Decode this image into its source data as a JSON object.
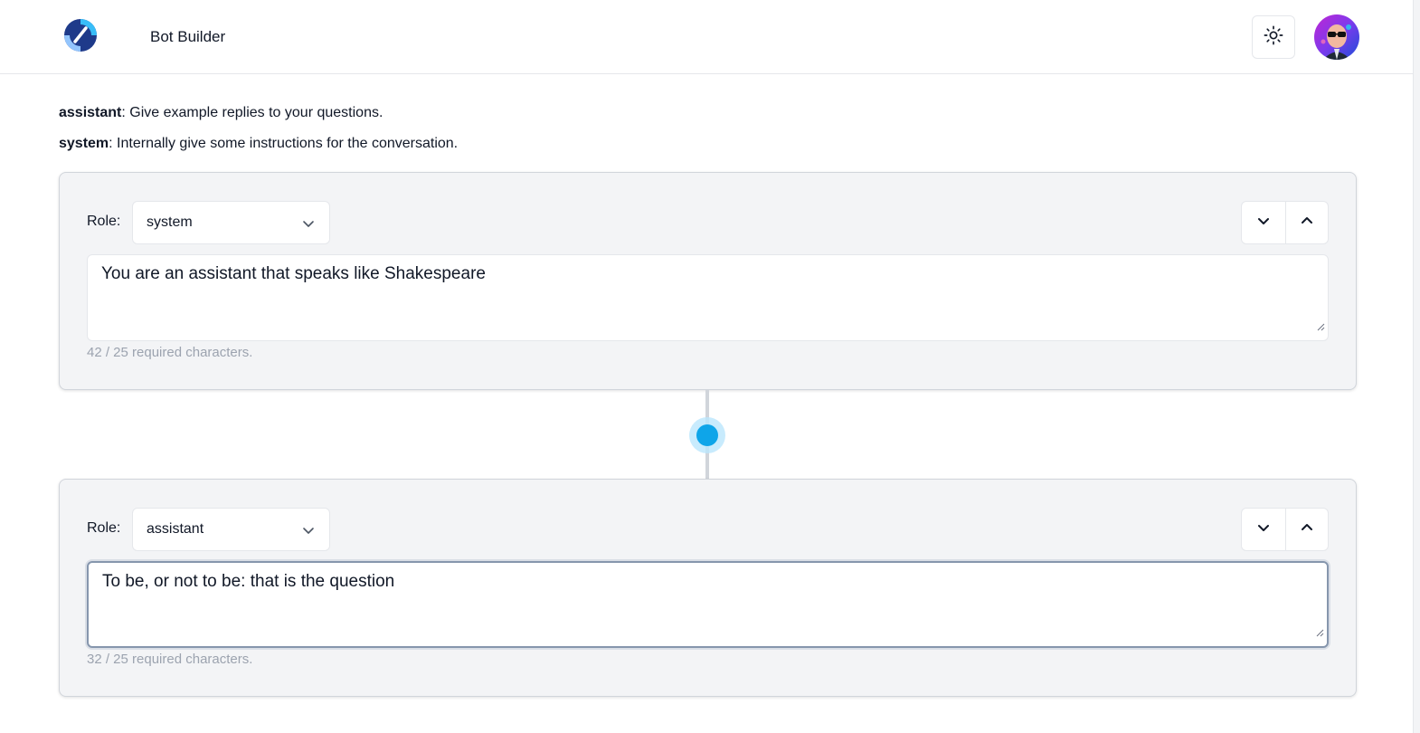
{
  "header": {
    "app_title": "Bot Builder",
    "logo_icon": "logo-icon",
    "theme_icon": "sun-icon",
    "avatar_icon": "avatar"
  },
  "legend": [
    {
      "role": "assistant",
      "description": ": Give example replies to your questions."
    },
    {
      "role": "system",
      "description": ": Internally give some instructions for the conversation."
    }
  ],
  "messages": [
    {
      "role_label": "Role:",
      "role": "system",
      "text": "You are an assistant that speaks like Shakespeare",
      "char_count": "42 / 25 required characters."
    },
    {
      "role_label": "Role:",
      "role": "assistant",
      "text": "To be, or not to be: that is the question",
      "char_count": "32 / 25 required characters."
    }
  ],
  "colors": {
    "accent": "#0ea5e9",
    "card_bg": "#f3f4f6"
  }
}
